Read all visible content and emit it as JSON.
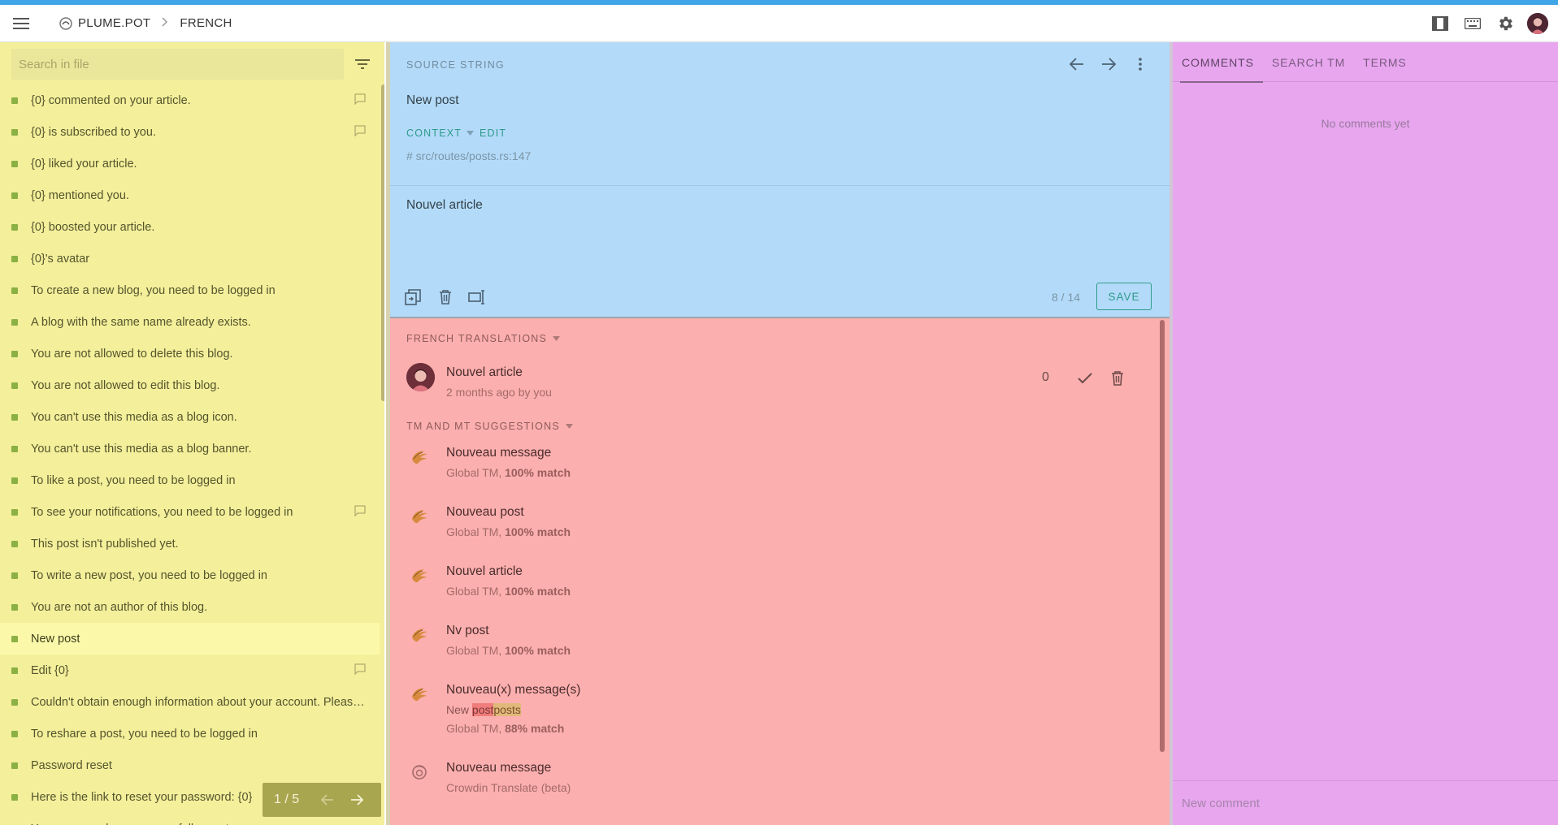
{
  "header": {
    "project": "PLUME.POT",
    "language": "FRENCH"
  },
  "search": {
    "placeholder": "Search in file"
  },
  "strings": [
    {
      "text": "{0} commented on your article.",
      "has_comment": true
    },
    {
      "text": "{0} is subscribed to you.",
      "has_comment": true
    },
    {
      "text": "{0} liked your article.",
      "has_comment": false
    },
    {
      "text": "{0} mentioned you.",
      "has_comment": false
    },
    {
      "text": "{0} boosted your article.",
      "has_comment": false
    },
    {
      "text": "{0}'s avatar",
      "has_comment": false
    },
    {
      "text": "To create a new blog, you need to be logged in",
      "has_comment": false
    },
    {
      "text": "A blog with the same name already exists.",
      "has_comment": false
    },
    {
      "text": "You are not allowed to delete this blog.",
      "has_comment": false
    },
    {
      "text": "You are not allowed to edit this blog.",
      "has_comment": false
    },
    {
      "text": "You can't use this media as a blog icon.",
      "has_comment": false
    },
    {
      "text": "You can't use this media as a blog banner.",
      "has_comment": false
    },
    {
      "text": "To like a post, you need to be logged in",
      "has_comment": false
    },
    {
      "text": "To see your notifications, you need to be logged in",
      "has_comment": true
    },
    {
      "text": "This post isn't published yet.",
      "has_comment": false
    },
    {
      "text": "To write a new post, you need to be logged in",
      "has_comment": false
    },
    {
      "text": "You are not an author of this blog.",
      "has_comment": false
    },
    {
      "text": "New post",
      "has_comment": false,
      "active": true
    },
    {
      "text": "Edit {0}",
      "has_comment": true
    },
    {
      "text": "Couldn't obtain enough information about your account. Please make sure your username is correct.",
      "has_comment": false
    },
    {
      "text": "To reshare a post, you need to be logged in",
      "has_comment": false
    },
    {
      "text": "Password reset",
      "has_comment": false
    },
    {
      "text": "Here is the link to reset your password: {0}",
      "has_comment": false
    },
    {
      "text": "Your password was successfully reset.",
      "has_comment": false
    }
  ],
  "pager": {
    "label": "1 / 5"
  },
  "source": {
    "label": "SOURCE STRING",
    "text": "New post",
    "context_label": "CONTEXT",
    "edit_label": "EDIT",
    "context_path": "# src/routes/posts.rs:147"
  },
  "editor": {
    "translation": "Nouvel article",
    "count": "8 / 14",
    "save_label": "SAVE"
  },
  "translations": {
    "heading": "FRENCH TRANSLATIONS",
    "items": [
      {
        "text": "Nouvel article",
        "meta": "2 months ago by you",
        "votes": "0"
      }
    ]
  },
  "suggestions": {
    "heading": "TM AND MT SUGGESTIONS",
    "items": [
      {
        "text": "Nouveau message",
        "source": "Global TM, ",
        "match": "100% match",
        "icon": "tm-icon"
      },
      {
        "text": "Nouveau post",
        "source": "Global TM, ",
        "match": "100% match",
        "icon": "tm-icon"
      },
      {
        "text": "Nouvel article",
        "source": "Global TM, ",
        "match": "100% match",
        "icon": "tm-icon"
      },
      {
        "text": "Nv post",
        "source": "Global TM, ",
        "match": "100% match",
        "icon": "tm-icon"
      },
      {
        "text": "Nouveau(x) message(s)",
        "diff_prefix": "New ",
        "diff_del": "post",
        "diff_ins": "posts",
        "source": "Global TM, ",
        "match": "88% match",
        "icon": "tm-icon"
      },
      {
        "text": "Nouveau message",
        "source": "Crowdin Translate (beta)",
        "match": "",
        "icon": "crowdin-icon"
      }
    ]
  },
  "right_panel": {
    "tabs": [
      "COMMENTS",
      "SEARCH TM",
      "TERMS"
    ],
    "empty": "No comments yet",
    "comment_placeholder": "New comment"
  },
  "colors": {
    "accent": "#2f9a8a",
    "top_stripe": "#3ea5e6",
    "left_panel": "#f3ef9b",
    "source_panel": "#b3dbf9",
    "suggestions_panel": "#fbafae",
    "right_panel": "#e8a6ef"
  }
}
